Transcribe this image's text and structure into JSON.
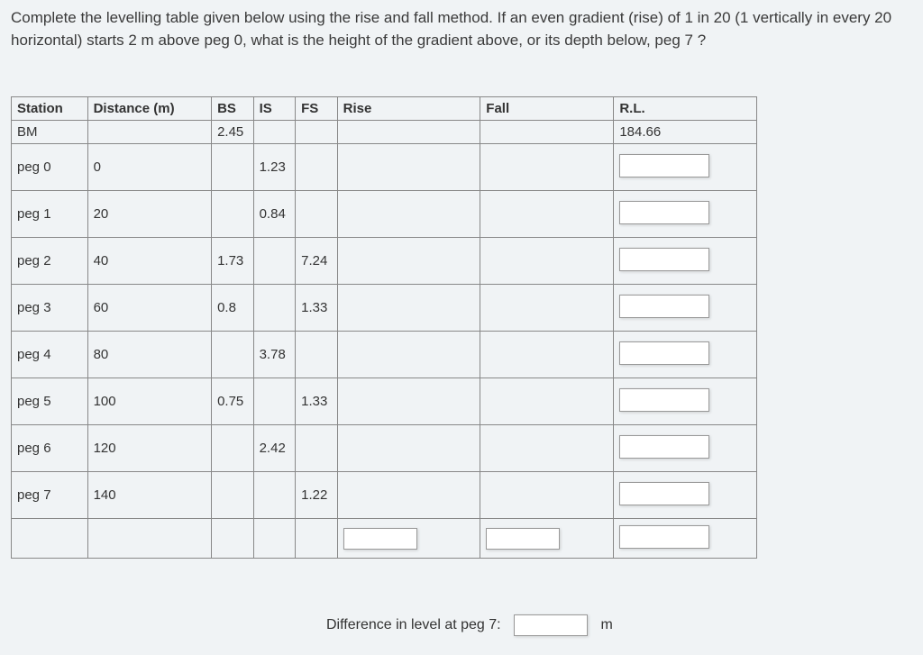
{
  "question": "Complete the levelling table given below using the rise and fall method.  If an even gradient (rise) of 1 in 20 (1 vertically in every 20 horizontal) starts 2 m above peg 0, what is the height of the gradient above, or its depth below, peg 7 ?",
  "headers": {
    "station": "Station",
    "distance": "Distance (m)",
    "bs": "BS",
    "is": "IS",
    "fs": "FS",
    "rise": "Rise",
    "fall": "Fall",
    "rl": "R.L."
  },
  "rows": [
    {
      "station": "BM",
      "distance": "",
      "bs": "2.45",
      "is": "",
      "fs": "",
      "rise": "",
      "fall": "",
      "rl": "184.66",
      "rlInput": false,
      "tall": false,
      "riseInput": false,
      "fallInput": false
    },
    {
      "station": "peg 0",
      "distance": "0",
      "bs": "",
      "is": "1.23",
      "fs": "",
      "rise": "",
      "fall": "",
      "rl": "",
      "rlInput": true,
      "tall": true,
      "riseInput": false,
      "fallInput": false
    },
    {
      "station": "peg 1",
      "distance": "20",
      "bs": "",
      "is": "0.84",
      "fs": "",
      "rise": "",
      "fall": "",
      "rl": "",
      "rlInput": true,
      "tall": true,
      "riseInput": false,
      "fallInput": false
    },
    {
      "station": "peg 2",
      "distance": "40",
      "bs": "1.73",
      "is": "",
      "fs": "7.24",
      "rise": "",
      "fall": "",
      "rl": "",
      "rlInput": true,
      "tall": true,
      "riseInput": false,
      "fallInput": false
    },
    {
      "station": "peg 3",
      "distance": "60",
      "bs": "0.8",
      "is": "",
      "fs": "1.33",
      "rise": "",
      "fall": "",
      "rl": "",
      "rlInput": true,
      "tall": true,
      "riseInput": false,
      "fallInput": false
    },
    {
      "station": "peg 4",
      "distance": "80",
      "bs": "",
      "is": "3.78",
      "fs": "",
      "rise": "",
      "fall": "",
      "rl": "",
      "rlInput": true,
      "tall": true,
      "riseInput": false,
      "fallInput": false
    },
    {
      "station": "peg 5",
      "distance": "100",
      "bs": "0.75",
      "is": "",
      "fs": "1.33",
      "rise": "",
      "fall": "",
      "rl": "",
      "rlInput": true,
      "tall": true,
      "riseInput": false,
      "fallInput": false
    },
    {
      "station": "peg 6",
      "distance": "120",
      "bs": "",
      "is": "2.42",
      "fs": "",
      "rise": "",
      "fall": "",
      "rl": "",
      "rlInput": true,
      "tall": true,
      "riseInput": false,
      "fallInput": false
    },
    {
      "station": "peg 7",
      "distance": "140",
      "bs": "",
      "is": "",
      "fs": "1.22",
      "rise": "",
      "fall": "",
      "rl": "",
      "rlInput": true,
      "tall": true,
      "riseInput": false,
      "fallInput": false
    },
    {
      "station": "",
      "distance": "",
      "bs": "",
      "is": "",
      "fs": "",
      "rise": "",
      "fall": "",
      "rl": "",
      "rlInput": true,
      "tall": false,
      "riseInput": true,
      "fallInput": true,
      "bottom": true
    }
  ],
  "footer": {
    "label": "Difference in level at peg 7:",
    "unit": "m"
  }
}
